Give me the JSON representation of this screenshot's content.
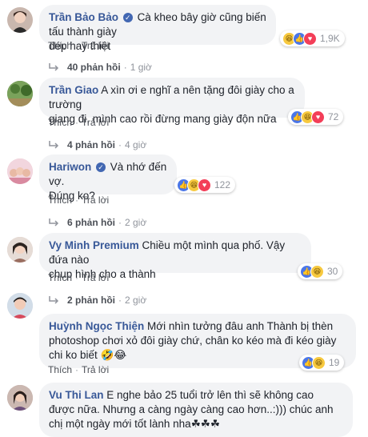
{
  "comments": [
    {
      "author": "Trần Bảo Bảo",
      "verified": true,
      "text_line1": "Cà kheo bây giờ cũng biến tấu thành giày",
      "text_line2": "dép hay thiệt",
      "reactions": [
        "haha",
        "like",
        "love"
      ],
      "reaction_count": "1,9K",
      "like_label": "Thích",
      "reply_label": "Trả lời",
      "replies_count": "40 phản hồi",
      "replies_time": "1 giờ"
    },
    {
      "author": "Trần Giao",
      "verified": false,
      "text_line1": "A xìn ơi e nghĩ a nên tặng đôi giày cho a trường",
      "text_line2": "giang đi, mình cao rồi đừng mang giày độn nữa",
      "reactions": [
        "like",
        "haha",
        "love"
      ],
      "reaction_count": "72",
      "like_label": "Thích",
      "reply_label": "Trả lời",
      "replies_count": "4 phản hồi",
      "replies_time": "4 giờ"
    },
    {
      "author": "Hariwon",
      "verified": true,
      "text_line1": "Và nhớ đến vợ.",
      "text_line2": "Đúng ko?",
      "reactions": [
        "like",
        "haha",
        "love"
      ],
      "reaction_count": "122",
      "like_label": "Thích",
      "reply_label": "Trả lời",
      "replies_count": "6 phản hồi",
      "replies_time": "2 giờ"
    },
    {
      "author": "Vy Minh Premium",
      "verified": false,
      "text_line1": "Chiều một mình qua phố. Vậy đứa nào",
      "text_line2": "chụp hình cho a thành",
      "reactions": [
        "like",
        "haha"
      ],
      "reaction_count": "30",
      "like_label": "Thích",
      "reply_label": "Trả lời",
      "replies_count": "2 phản hồi",
      "replies_time": "2 giờ"
    },
    {
      "author": "Huỳnh Ngọc Thiện",
      "verified": false,
      "text_line1": "Mới nhìn tưởng đâu anh Thành bị thèn",
      "text_line2": "photoshop chơi xỏ đôi giày chứ, chân ko kéo mà đi kéo giày",
      "text_line3": "chi ko biết 🤣😂",
      "reactions": [
        "like",
        "haha"
      ],
      "reaction_count": "19",
      "like_label": "Thích",
      "reply_label": "Trả lời"
    },
    {
      "author": "Vu Thi Lan",
      "verified": false,
      "text_line1": "E nghe bảo 25 tuổi trở lên thì sẽ không cao",
      "text_line2": "được nữa. Nhưng a càng ngày càng cao hơn..:))) chúc anh",
      "text_line3": "chị một ngày mới tốt lành nha☘☘☘"
    }
  ],
  "colors": {
    "author": "#385898",
    "bubble": "#f2f3f5",
    "meta": "#90949c",
    "like": "#4a76e8",
    "haha": "#f7c93f",
    "love": "#f33e58"
  }
}
